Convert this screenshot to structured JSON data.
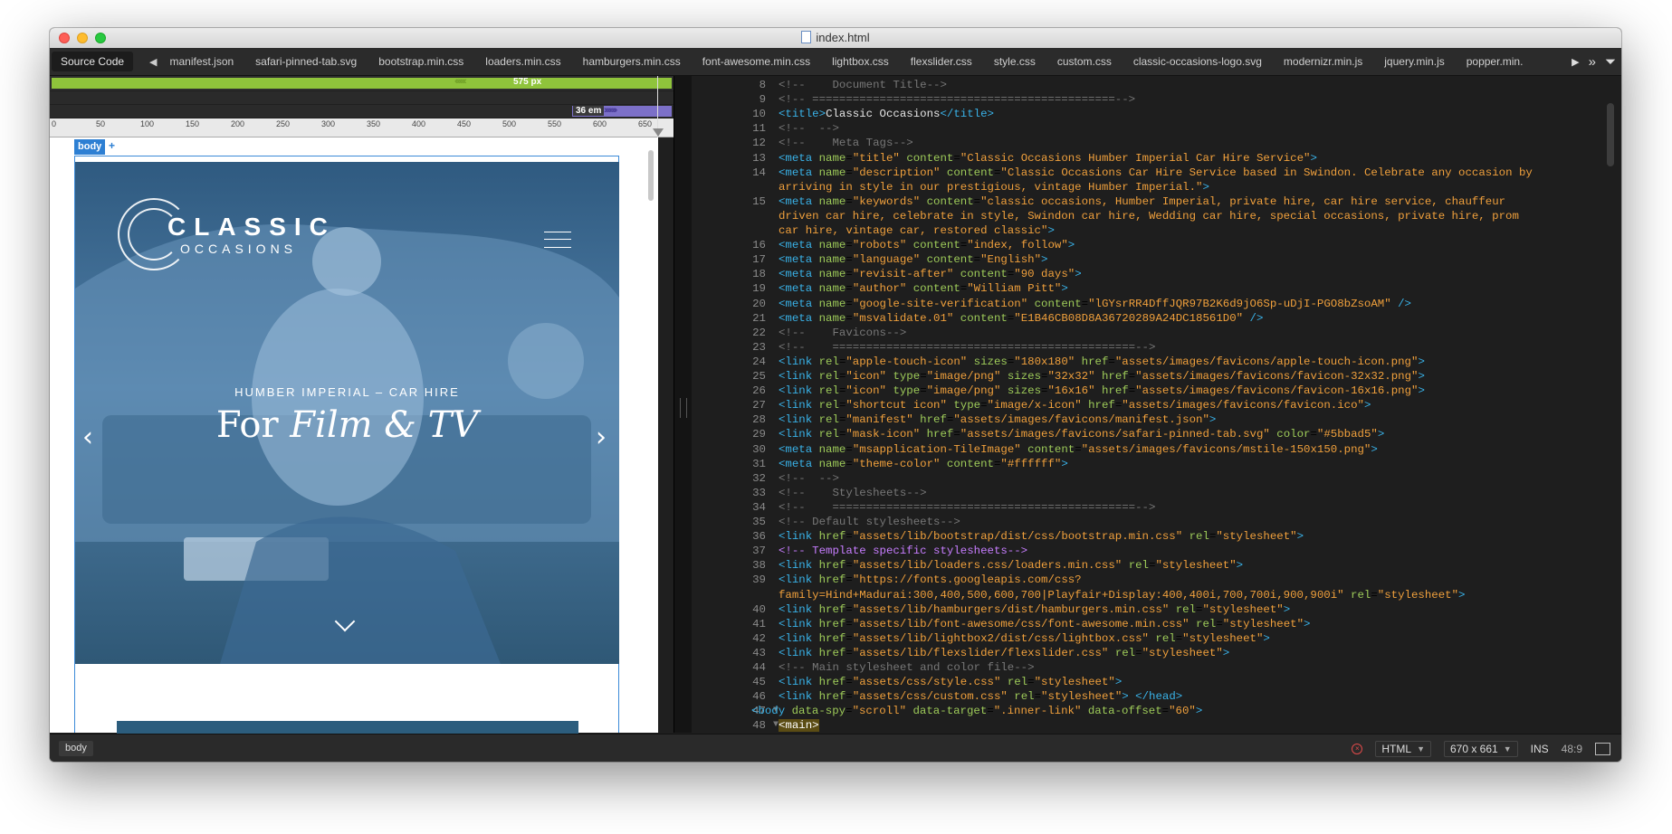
{
  "window": {
    "title": "index.html"
  },
  "toolbar": {
    "source_tab": "Source Code",
    "tabs": [
      "manifest.json",
      "safari-pinned-tab.svg",
      "bootstrap.min.css",
      "loaders.min.css",
      "hamburgers.min.css",
      "font-awesome.min.css",
      "lightbox.css",
      "flexslider.css",
      "style.css",
      "custom.css",
      "classic-occasions-logo.svg",
      "modernizr.min.js",
      "jquery.min.js",
      "popper.min."
    ]
  },
  "media_queries": {
    "width_px": "575 px",
    "width_em": "36 em"
  },
  "ruler": {
    "ticks": [
      "0",
      "50",
      "100",
      "150",
      "200",
      "250",
      "300",
      "350",
      "400",
      "450",
      "500",
      "550",
      "600",
      "650"
    ]
  },
  "preview": {
    "body_tag": "body",
    "logo_line1": "CLASSIC",
    "logo_line2": "OCCASIONS",
    "eyebrow": "HUMBER IMPERIAL – CAR HIRE",
    "headline_plain": "For ",
    "headline_italic": "Film & TV",
    "prev_arrow": "‹",
    "next_arrow": "›"
  },
  "code": {
    "lines": [
      {
        "n": "8",
        "html": "<span class='cm'>&lt;!--    Document Title--&gt;</span>"
      },
      {
        "n": "9",
        "html": "<span class='cm'>&lt;!-- =============================================--&gt;</span>"
      },
      {
        "n": "10",
        "html": "<span class='tg'>&lt;title&gt;</span><span class='tx'>Classic Occasions</span><span class='tg'>&lt;/title&gt;</span>"
      },
      {
        "n": "11",
        "html": "<span class='cm'>&lt;!--  --&gt;</span>"
      },
      {
        "n": "12",
        "html": "<span class='cm'>&lt;!--    Meta Tags--&gt;</span>"
      },
      {
        "n": "13",
        "html": "<span class='tg'>&lt;meta</span> <span class='at'>name</span>=<span class='st'>\"title\"</span> <span class='at'>content</span>=<span class='st'>\"Classic Occasions Humber Imperial Car Hire Service\"</span><span class='tg'>&gt;</span>"
      },
      {
        "n": "14",
        "html": "<span class='tg'>&lt;meta</span> <span class='at'>name</span>=<span class='st'>\"description\"</span> <span class='at'>content</span>=<span class='st'>\"Classic Occasions Car Hire Service based in Swindon. Celebrate any occasion by</span>"
      },
      {
        "n": "",
        "html": "<span class='st'>arriving in style in our prestigious, vintage Humber Imperial.\"</span><span class='tg'>&gt;</span>"
      },
      {
        "n": "15",
        "html": "<span class='tg'>&lt;meta</span> <span class='at'>name</span>=<span class='st'>\"keywords\"</span> <span class='at'>content</span>=<span class='st'>\"classic occasions, Humber Imperial, private hire, car hire service, chauffeur</span>"
      },
      {
        "n": "",
        "html": "<span class='st'>driven car hire, celebrate in style, Swindon car hire, Wedding car hire, special occasions, private hire, prom</span>"
      },
      {
        "n": "",
        "html": "<span class='st'>car hire, vintage car, restored classic\"</span><span class='tg'>&gt;</span>"
      },
      {
        "n": "16",
        "html": "<span class='tg'>&lt;meta</span> <span class='at'>name</span>=<span class='st'>\"robots\"</span> <span class='at'>content</span>=<span class='st'>\"index, follow\"</span><span class='tg'>&gt;</span>"
      },
      {
        "n": "17",
        "html": "<span class='tg'>&lt;meta</span> <span class='at'>name</span>=<span class='st'>\"language\"</span> <span class='at'>content</span>=<span class='st'>\"English\"</span><span class='tg'>&gt;</span>"
      },
      {
        "n": "18",
        "html": "<span class='tg'>&lt;meta</span> <span class='at'>name</span>=<span class='st'>\"revisit-after\"</span> <span class='at'>content</span>=<span class='st'>\"90 days\"</span><span class='tg'>&gt;</span>"
      },
      {
        "n": "19",
        "html": "<span class='tg'>&lt;meta</span> <span class='at'>name</span>=<span class='st'>\"author\"</span> <span class='at'>content</span>=<span class='st'>\"William Pitt\"</span><span class='tg'>&gt;</span>"
      },
      {
        "n": "20",
        "html": "<span class='tg'>&lt;meta</span> <span class='at'>name</span>=<span class='st'>\"google-site-verification\"</span> <span class='at'>content</span>=<span class='st'>\"lGYsrRR4DffJQR97B2K6d9jO6Sp-uDjI-PGO8bZsoAM\"</span> <span class='tg'>/&gt;</span>"
      },
      {
        "n": "21",
        "html": "<span class='tg'>&lt;meta</span> <span class='at'>name</span>=<span class='st'>\"msvalidate.01\"</span> <span class='at'>content</span>=<span class='st'>\"E1B46CB08D8A36720289A24DC18561D0\"</span> <span class='tg'>/&gt;</span>"
      },
      {
        "n": "22",
        "html": "<span class='cm'>&lt;!--    Favicons--&gt;</span>"
      },
      {
        "n": "23",
        "html": "<span class='cm'>&lt;!--    =============================================--&gt;</span>"
      },
      {
        "n": "24",
        "html": "<span class='tg'>&lt;link</span> <span class='at'>rel</span>=<span class='st'>\"apple-touch-icon\"</span> <span class='at'>sizes</span>=<span class='st'>\"180x180\"</span> <span class='at'>href</span>=<span class='st'>\"assets/images/favicons/apple-touch-icon.png\"</span><span class='tg'>&gt;</span>"
      },
      {
        "n": "25",
        "html": "<span class='tg'>&lt;link</span> <span class='at'>rel</span>=<span class='st'>\"icon\"</span> <span class='at'>type</span>=<span class='st'>\"image/png\"</span> <span class='at'>sizes</span>=<span class='st'>\"32x32\"</span> <span class='at'>href</span>=<span class='st'>\"assets/images/favicons/favicon-32x32.png\"</span><span class='tg'>&gt;</span>"
      },
      {
        "n": "26",
        "html": "<span class='tg'>&lt;link</span> <span class='at'>rel</span>=<span class='st'>\"icon\"</span> <span class='at'>type</span>=<span class='st'>\"image/png\"</span> <span class='at'>sizes</span>=<span class='st'>\"16x16\"</span> <span class='at'>href</span>=<span class='st'>\"assets/images/favicons/favicon-16x16.png\"</span><span class='tg'>&gt;</span>"
      },
      {
        "n": "27",
        "html": "<span class='tg'>&lt;link</span> <span class='at'>rel</span>=<span class='st'>\"shortcut icon\"</span> <span class='at'>type</span>=<span class='st'>\"image/x-icon\"</span> <span class='at'>href</span>=<span class='st'>\"assets/images/favicons/favicon.ico\"</span><span class='tg'>&gt;</span>"
      },
      {
        "n": "28",
        "html": "<span class='tg'>&lt;link</span> <span class='at'>rel</span>=<span class='st'>\"manifest\"</span> <span class='at'>href</span>=<span class='st'>\"assets/images/favicons/manifest.json\"</span><span class='tg'>&gt;</span>"
      },
      {
        "n": "29",
        "html": "<span class='tg'>&lt;link</span> <span class='at'>rel</span>=<span class='st'>\"mask-icon\"</span> <span class='at'>href</span>=<span class='st'>\"assets/images/favicons/safari-pinned-tab.svg\"</span> <span class='at'>color</span>=<span class='st'>\"#5bbad5\"</span><span class='tg'>&gt;</span>"
      },
      {
        "n": "30",
        "html": "<span class='tg'>&lt;meta</span> <span class='at'>name</span>=<span class='st'>\"msapplication-TileImage\"</span> <span class='at'>content</span>=<span class='st'>\"assets/images/favicons/mstile-150x150.png\"</span><span class='tg'>&gt;</span>"
      },
      {
        "n": "31",
        "html": "<span class='tg'>&lt;meta</span> <span class='at'>name</span>=<span class='st'>\"theme-color\"</span> <span class='at'>content</span>=<span class='st'>\"#ffffff\"</span><span class='tg'>&gt;</span>"
      },
      {
        "n": "32",
        "html": "<span class='cm'>&lt;!--  --&gt;</span>"
      },
      {
        "n": "33",
        "html": "<span class='cm'>&lt;!--    Stylesheets--&gt;</span>"
      },
      {
        "n": "34",
        "html": "<span class='cm'>&lt;!--    =============================================--&gt;</span>"
      },
      {
        "n": "35",
        "html": "<span class='cm'>&lt;!-- Default stylesheets--&gt;</span>"
      },
      {
        "n": "36",
        "html": "<span class='tg'>&lt;link</span> <span class='at'>href</span>=<span class='st'>\"assets/lib/bootstrap/dist/css/bootstrap.min.css\"</span> <span class='at'>rel</span>=<span class='st'>\"stylesheet\"</span><span class='tg'>&gt;</span>"
      },
      {
        "n": "37",
        "html": "<span class='cs'>&lt;!-- Template specific stylesheets--&gt;</span>"
      },
      {
        "n": "38",
        "html": "<span class='tg'>&lt;link</span> <span class='at'>href</span>=<span class='st'>\"assets/lib/loaders.css/loaders.min.css\"</span> <span class='at'>rel</span>=<span class='st'>\"stylesheet\"</span><span class='tg'>&gt;</span>"
      },
      {
        "n": "39",
        "html": "<span class='tg'>&lt;link</span> <span class='at'>href</span>=<span class='st'>\"https://fonts.googleapis.com/css?</span>"
      },
      {
        "n": "",
        "html": "<span class='st'>family=Hind+Madurai:300,400,500,600,700|Playfair+Display:400,400i,700,700i,900,900i\"</span> <span class='at'>rel</span>=<span class='st'>\"stylesheet\"</span><span class='tg'>&gt;</span>"
      },
      {
        "n": "40",
        "html": "<span class='tg'>&lt;link</span> <span class='at'>href</span>=<span class='st'>\"assets/lib/hamburgers/dist/hamburgers.min.css\"</span> <span class='at'>rel</span>=<span class='st'>\"stylesheet\"</span><span class='tg'>&gt;</span>"
      },
      {
        "n": "41",
        "html": "<span class='tg'>&lt;link</span> <span class='at'>href</span>=<span class='st'>\"assets/lib/font-awesome/css/font-awesome.min.css\"</span> <span class='at'>rel</span>=<span class='st'>\"stylesheet\"</span><span class='tg'>&gt;</span>"
      },
      {
        "n": "42",
        "html": "<span class='tg'>&lt;link</span> <span class='at'>href</span>=<span class='st'>\"assets/lib/lightbox2/dist/css/lightbox.css\"</span> <span class='at'>rel</span>=<span class='st'>\"stylesheet\"</span><span class='tg'>&gt;</span>"
      },
      {
        "n": "43",
        "html": "<span class='tg'>&lt;link</span> <span class='at'>href</span>=<span class='st'>\"assets/lib/flexslider/flexslider.css\"</span> <span class='at'>rel</span>=<span class='st'>\"stylesheet\"</span><span class='tg'>&gt;</span>"
      },
      {
        "n": "44",
        "html": "<span class='cm'>&lt;!-- Main stylesheet and color file--&gt;</span>"
      },
      {
        "n": "45",
        "html": "<span class='tg'>&lt;link</span> <span class='at'>href</span>=<span class='st'>\"assets/css/style.css\"</span> <span class='at'>rel</span>=<span class='st'>\"stylesheet\"</span><span class='tg'>&gt;</span>"
      },
      {
        "n": "46",
        "html": "<span class='tg'>&lt;link</span> <span class='at'>href</span>=<span class='st'>\"assets/css/custom.css\"</span> <span class='at'>rel</span>=<span class='st'>\"stylesheet\"</span><span class='tg'>&gt;</span> <span class='tg'>&lt;/head&gt;</span>"
      },
      {
        "n": "47",
        "fold": true,
        "indent": -30,
        "html": "<span class='tg'>&lt;body</span> <span class='at'>data-spy</span>=<span class='st'>\"scroll\"</span> <span class='at'>data-target</span>=<span class='st'>\".inner-link\"</span> <span class='at'>data-offset</span>=<span class='st'>\"60\"</span><span class='tg'>&gt;</span>"
      },
      {
        "n": "48",
        "fold": true,
        "html": "<span class='hl'>&lt;main&gt;</span>"
      }
    ]
  },
  "status": {
    "breadcrumb": "body",
    "language": "HTML",
    "viewport": "670 x 661",
    "mode": "INS",
    "cursor": "48:9"
  },
  "colors": {
    "accent_green": "#8fc43b",
    "accent_purple": "#7c70c8",
    "hero_blue": "#3d6d94"
  }
}
